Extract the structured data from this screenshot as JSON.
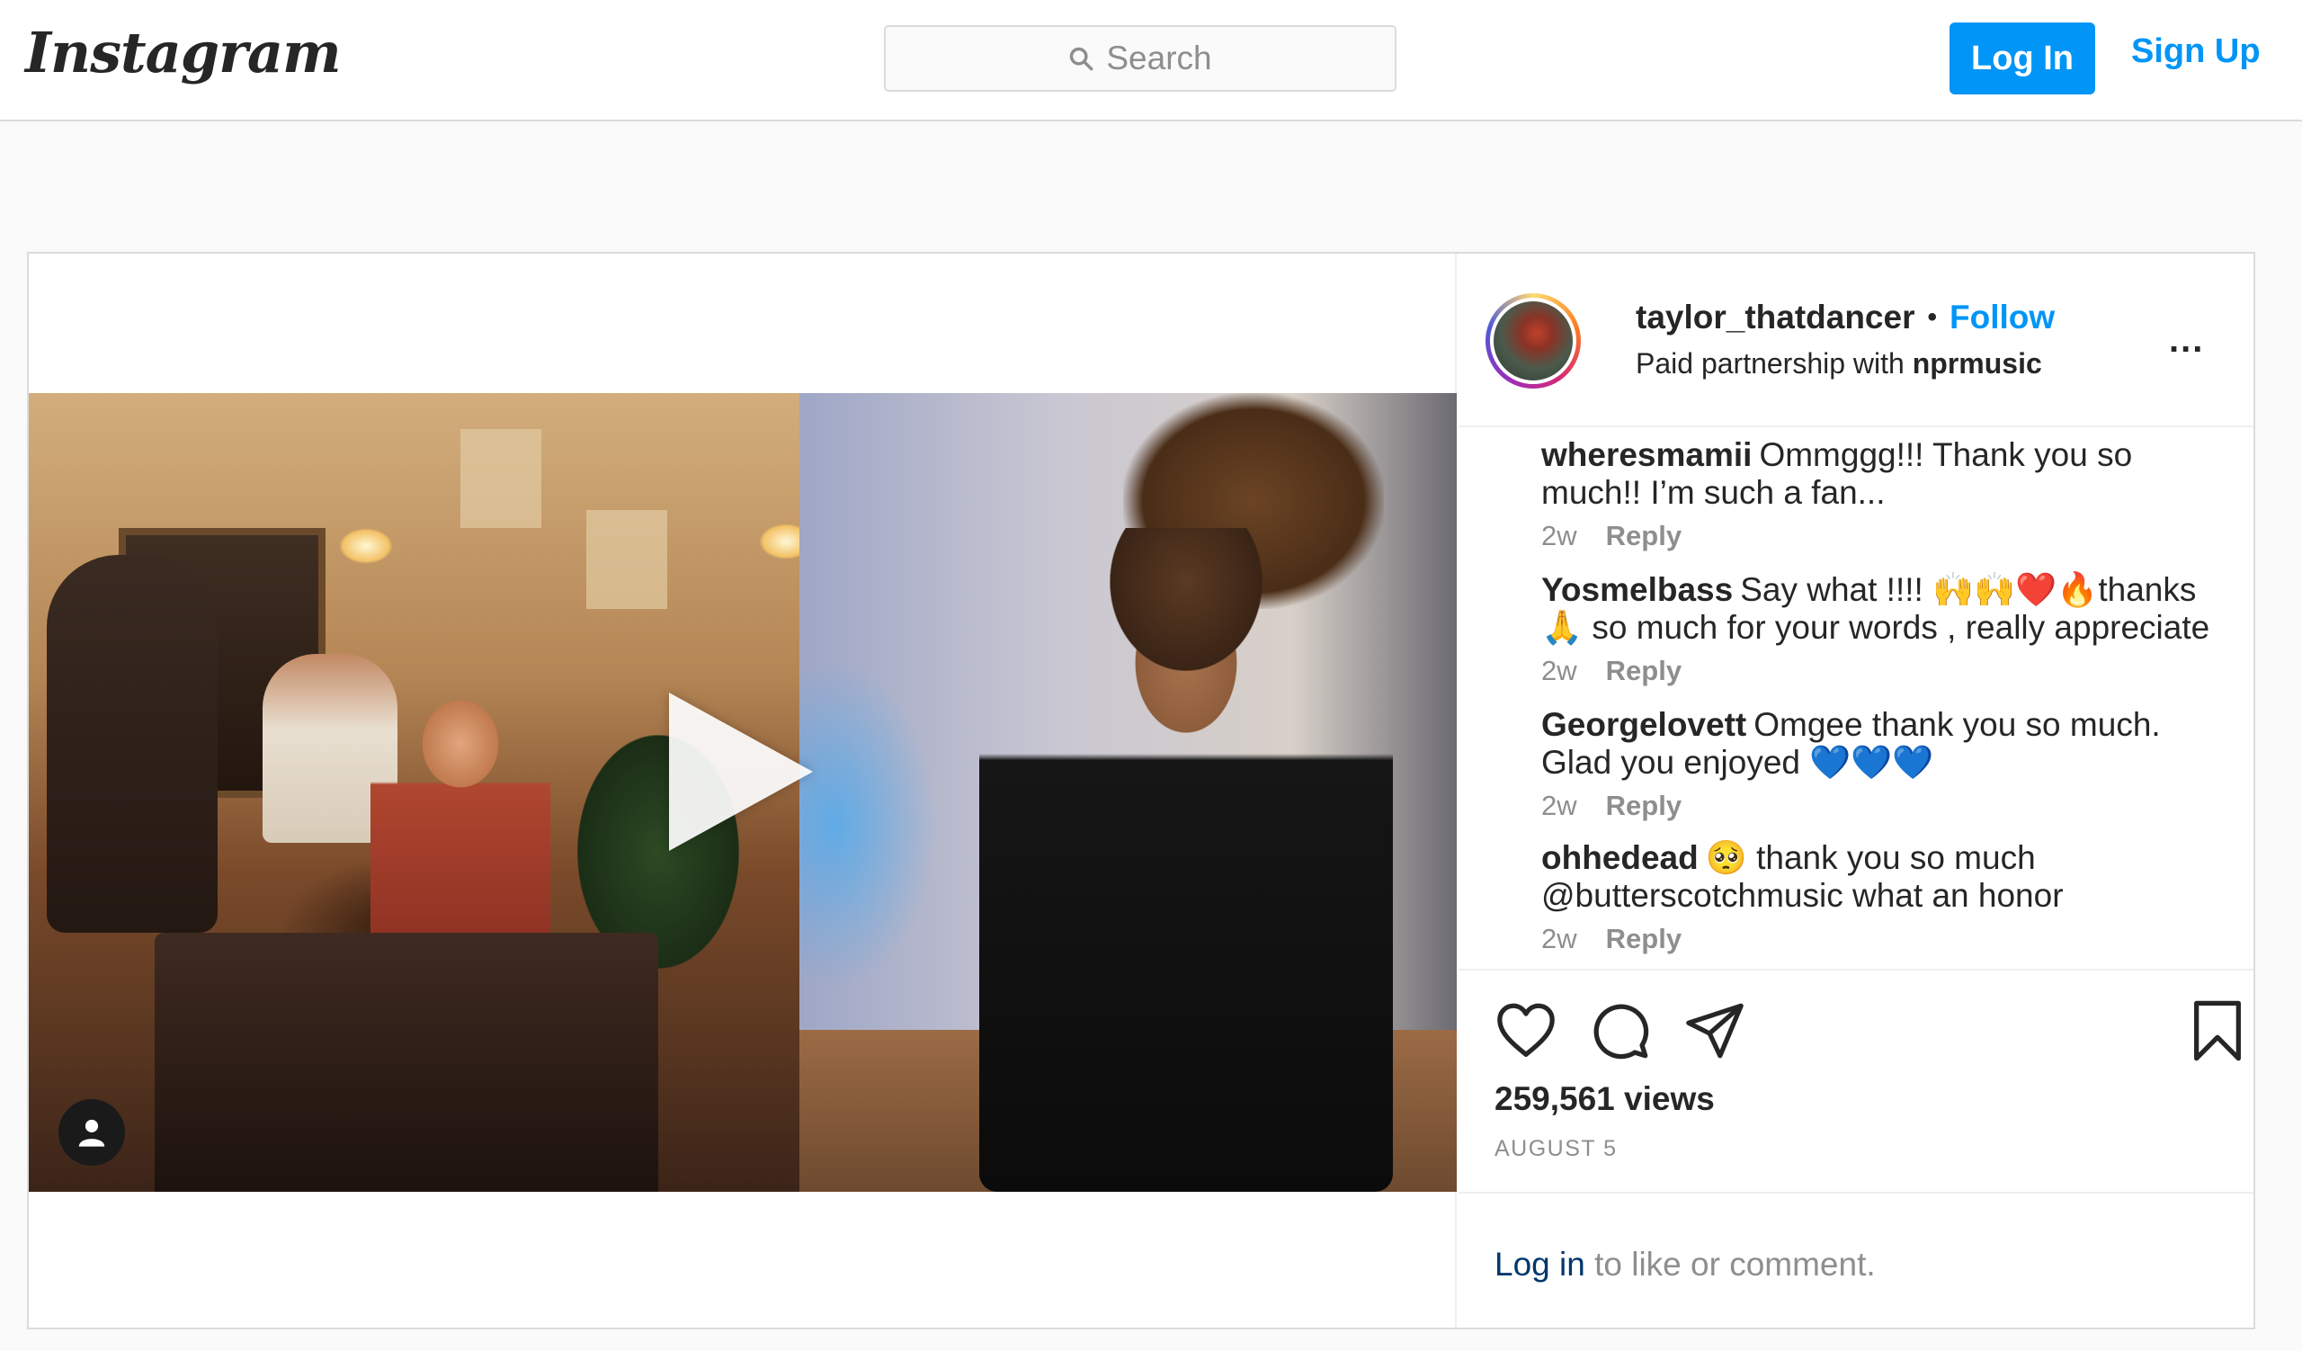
{
  "header": {
    "logo_text": "Instagram",
    "search_placeholder": "Search",
    "login_label": "Log In",
    "signup_label": "Sign Up"
  },
  "post": {
    "username": "taylor_thatdancer",
    "separator": "•",
    "follow_label": "Follow",
    "partnership_prefix": "Paid partnership with",
    "partner": "nprmusic",
    "more_label": "...",
    "comments": [
      {
        "user": "wheresmamii",
        "text": "Ommggg!!! Thank you so much!! I’m such a fan...",
        "age": "2w",
        "reply": "Reply"
      },
      {
        "user": "Yosmelbass",
        "text": "Say what !!!! 🙌🙌❤️🔥thanks🙏 so much for your words , really appreciate",
        "age": "2w",
        "reply": "Reply"
      },
      {
        "user": "Georgelovett",
        "text": "Omgee thank you so much. Glad you enjoyed 💙💙💙",
        "age": "2w",
        "reply": "Reply"
      },
      {
        "user": "ohhedead",
        "text": "🥺 thank you so much @butterscotchmusic what an honor",
        "age": "2w",
        "reply": "Reply"
      }
    ],
    "icons": {
      "like": "heart-icon",
      "comment": "comment-icon",
      "share": "paper-plane-icon",
      "save": "bookmark-icon",
      "play": "play-icon",
      "user_tag": "user-tag-icon"
    },
    "views": "259,561 views",
    "date": "AUGUST 5",
    "login_link": "Log in",
    "login_suffix": "to like or comment."
  },
  "colors": {
    "accent": "#0095f6",
    "text": "#262626",
    "muted": "#8e8e8e",
    "border": "#dbdbdb",
    "background": "#fafafa"
  }
}
